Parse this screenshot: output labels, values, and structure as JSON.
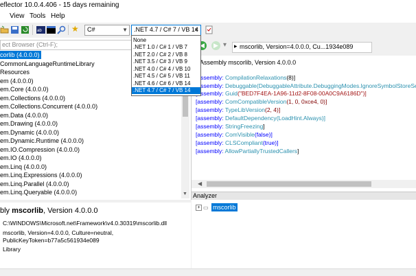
{
  "window": {
    "title": "eflector 10.0.4.406 - 15 days remaining"
  },
  "menu": {
    "items": [
      "View",
      "Tools",
      "Help"
    ]
  },
  "toolbar": {
    "language": "C#",
    "framework": ".NET 4.7 / C# 7 / VB 14"
  },
  "framework_dropdown": {
    "options": [
      "None",
      ".NET 1.0 / C# 1 / VB 7",
      ".NET 2.0 / C# 2 / VB 8",
      ".NET 3.5 / C# 3 / VB 9",
      ".NET 4.0 / C# 4 / VB 10",
      ".NET 4.5 / C# 5 / VB 11",
      ".NET 4.6 / C# 6 / VB 14",
      ".NET 4.7 / C# 7 / VB 14"
    ],
    "selected_index": 7
  },
  "browser": {
    "search_placeholder": "ect Browser (Ctrl-F);",
    "items": [
      "corlib (4.0.0.0)",
      "CommonLanguageRuntimeLibrary",
      "Resources",
      "em (4.0.0.0)",
      "em.Core (4.0.0.0)",
      "em.Collections (4.0.0.0)",
      "em.Collections.Concurrent (4.0.0.0)",
      "em.Data (4.0.0.0)",
      "em.Drawing (4.0.0.0)",
      "em.Dynamic (4.0.0.0)",
      "em.Dynamic.Runtime (4.0.0.0)",
      "em.IO.Compression (4.0.0.0)",
      "em.IO (4.0.0.0)",
      "em.Linq (4.0.0.0)",
      "em.Linq.Expressions (4.0.0.0)",
      "em.Linq.Parallel (4.0.0.0)",
      "em.Linq.Queryable (4.0.0.0)"
    ]
  },
  "info": {
    "heading_prefix": "bly ",
    "heading_name": "mscorlib",
    "heading_suffix": ", Version 4.0.0.0",
    "path": "C:\\WINDOWS\\Microsoft.net\\Framework\\v4.0.30319\\mscorlib.dll",
    "name_line1": "mscorlib, Version=4.0.0.0, Culture=neutral,",
    "name_line2": "PublicKeyToken=b77a5c561934e089",
    "type": "Library"
  },
  "navbar": {
    "address": "mscorlib, Version=4.0.0.0, Cu...1934e089"
  },
  "code": {
    "header_prefix": "Assembly ",
    "header_name": "mscorlib",
    "header_suffix": ", Version 4.0.0.0",
    "lines": [
      {
        "kw": "assembly:",
        "name": "CompilationRelaxations",
        "args": "(8)]",
        "pre": "["
      },
      {
        "kw": "assembly:",
        "name": "Debuggable",
        "args": "(DebuggableAttribute.DebuggingModes.IgnoreSymbolStoreSeq",
        "pre": "["
      },
      {
        "kw": "assembly:",
        "name": "Guid",
        "args": "(\"BED7F4EA-1A96-11d2-8F08-00A0C9A6186D\")]",
        "pre": "["
      },
      {
        "kw": "assembly:",
        "name": "ComCompatibleVersion",
        "args": "(1, 0, 0xce4, 0)]",
        "pre": "["
      },
      {
        "kw": "assembly:",
        "name": "TypeLibVersion",
        "args": "(2, 4)]",
        "pre": "["
      },
      {
        "kw": "assembly:",
        "name": "DefaultDependency",
        "args": "(LoadHint.Always)]",
        "pre": "["
      },
      {
        "kw": "assembly:",
        "name": "StringFreezing",
        "args": "]",
        "pre": "["
      },
      {
        "kw": "assembly:",
        "name": "ComVisible",
        "args": "(false)]",
        "pre": "["
      },
      {
        "kw": "assembly:",
        "name": "CLSCompliant",
        "args": "(true)]",
        "pre": "["
      },
      {
        "kw": "assembly:",
        "name": "AllowPartiallyTrustedCallers",
        "args": "]",
        "pre": "["
      }
    ]
  },
  "analyzer": {
    "title": "Analyzer",
    "node": "mscorlib",
    "expander": "+"
  },
  "colors": {
    "selection": "#0078d7",
    "keyword": "#0000ff",
    "type": "#2b91af",
    "string": "#a31515"
  }
}
